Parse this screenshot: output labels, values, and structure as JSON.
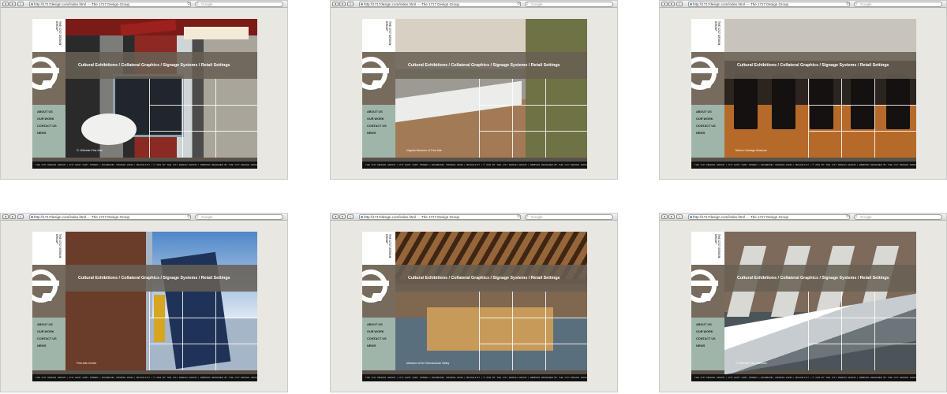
{
  "browser": {
    "url": "http://1717design.com/index.html",
    "title": "The 1717 Design Group",
    "search_placeholder": "Google"
  },
  "site": {
    "brand": "THE 1717 DESIGN GROUP",
    "tagline": "Cultural Exhibitions / Collateral Graphics / Signage Systems / Retail Settings",
    "nav": [
      "ABOUT US",
      "OUR WORK",
      "CONTACT US",
      "NEWS"
    ],
    "footer": "THE 1717 DESIGN GROUP  |  1717 EAST CARY STREET  |  RICHMOND, VIRGINIA 23223  |  804.644.1717  |  © 2011 BY THE 1717 DESIGN GROUP  |  WEBSITE DESIGNED BY THE 1717 DESIGN GROUP"
  },
  "screens": [
    {
      "caption": "G. Wheeler Fine Arts"
    },
    {
      "caption": "Virginia Museum of Fine Arts"
    },
    {
      "caption": "Marion Carriage Museum"
    },
    {
      "caption": "Fine Arts Center"
    },
    {
      "caption": "Museum of the Shenandoah Valley"
    },
    {
      "caption": "G. Wheeler Lind Museum"
    }
  ]
}
